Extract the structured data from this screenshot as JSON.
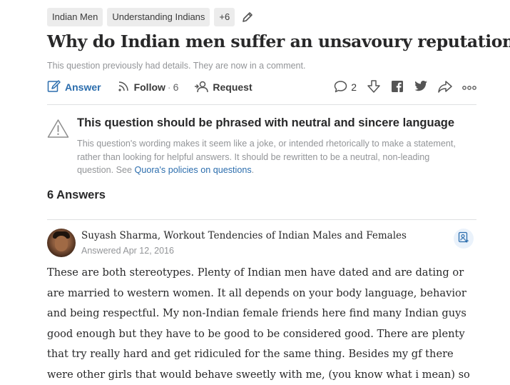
{
  "topics": {
    "items": [
      {
        "label": "Indian Men"
      },
      {
        "label": "Understanding Indians"
      }
    ],
    "more": "+6"
  },
  "question": {
    "title": "Why do Indian men suffer an unsavoury reputation?",
    "details_note": "This question previously had details. They are now in a comment."
  },
  "actions": {
    "answer": "Answer",
    "follow": "Follow",
    "follow_dot": "·",
    "follow_count": "6",
    "request": "Request",
    "comment_count": "2"
  },
  "warning": {
    "title": "This question should be phrased with neutral and sincere language",
    "body_lines": [
      "This question's wording makes it seem like a joke, or intended rhetorically to make a statement,",
      "rather than looking for helpful answers. It should be rewritten to be a neutral, non-leading",
      "question. See "
    ],
    "link_text": "Quora's policies on questions",
    "after_link": "."
  },
  "answers_count": "6 Answers",
  "answer": {
    "author": "Suyash Sharma, Workout Tendencies of Indian Males and Females",
    "date": "Answered Apr 12, 2016",
    "lines": [
      "These are both stereotypes. Plenty of Indian men have dated and are dating or",
      "are married to western women. It all depends on your body language, behavior",
      "and being respectful. My non-Indian female friends here find many Indian guys",
      "good enough but they have to be good to be considered good. There are plenty",
      "that try really hard and get ridiculed for the same thing. Besides my gf there",
      "were other girls that would behave sweetly with me, (you know what i mean) so"
    ]
  },
  "colors": {
    "link_blue": "#2b6dad",
    "chip_bg": "#ececec",
    "muted_text": "#939598"
  },
  "icons": [
    "pencil-icon",
    "answer-edit-icon",
    "follow-rss-icon",
    "request-person-icon",
    "comment-icon",
    "downvote-icon",
    "facebook-icon",
    "twitter-icon",
    "share-icon",
    "more-icon",
    "warning-triangle-icon",
    "follow-person-icon"
  ]
}
